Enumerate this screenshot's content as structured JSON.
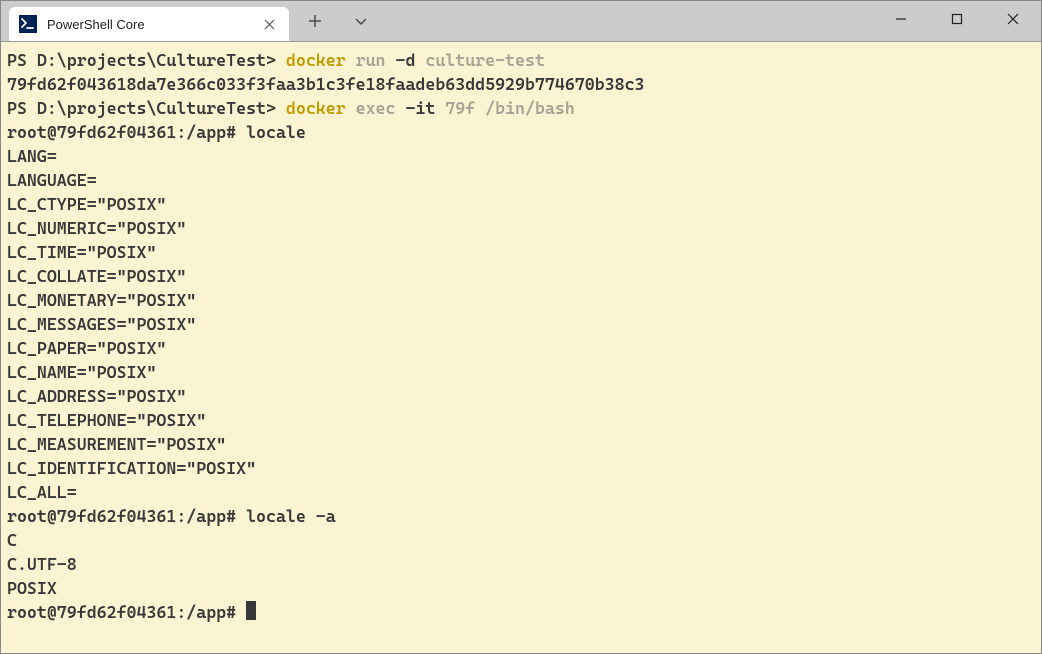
{
  "window": {
    "tab": {
      "title": "PowerShell Core",
      "icon_text": ">_"
    }
  },
  "terminal": {
    "line1": {
      "prompt": "PS D:\\projects\\CultureTest> ",
      "cmd_yellow": "docker",
      "cmd_gray1": " run ",
      "cmd_dash": "-d",
      "cmd_gray2": " culture-test"
    },
    "line2": "79fd62f043618da7e366c033f3faa3b1c3fe18faadeb63dd5929b774670b38c3",
    "line3": {
      "prompt": "PS D:\\projects\\CultureTest> ",
      "cmd_yellow": "docker",
      "cmd_gray1": " exec ",
      "cmd_dash": "-it",
      "cmd_gray2": " 79f /bin/bash"
    },
    "line4": "root@79fd62f04361:/app# locale",
    "locale_output": [
      "LANG=",
      "LANGUAGE=",
      "LC_CTYPE=\"POSIX\"",
      "LC_NUMERIC=\"POSIX\"",
      "LC_TIME=\"POSIX\"",
      "LC_COLLATE=\"POSIX\"",
      "LC_MONETARY=\"POSIX\"",
      "LC_MESSAGES=\"POSIX\"",
      "LC_PAPER=\"POSIX\"",
      "LC_NAME=\"POSIX\"",
      "LC_ADDRESS=\"POSIX\"",
      "LC_TELEPHONE=\"POSIX\"",
      "LC_MEASUREMENT=\"POSIX\"",
      "LC_IDENTIFICATION=\"POSIX\"",
      "LC_ALL="
    ],
    "line_locale_a": "root@79fd62f04361:/app# locale -a",
    "locale_a_output": [
      "C",
      "C.UTF-8",
      "POSIX"
    ],
    "final_prompt": "root@79fd62f04361:/app# "
  }
}
